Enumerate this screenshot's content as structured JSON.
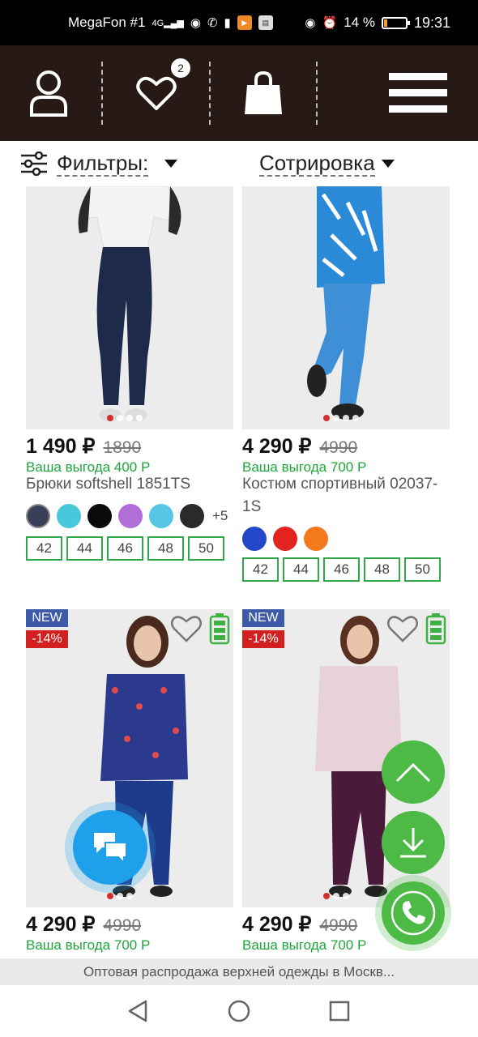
{
  "status_bar": {
    "carrier": "MegaFon #1",
    "signal_label": "4G",
    "battery": "14 %",
    "time": "19:31",
    "battery_level": 0.14
  },
  "header": {
    "account_icon": "user-icon",
    "wishlist_icon": "heart-icon",
    "wishlist_count": "2",
    "cart_icon": "bag-icon",
    "menu_icon": "hamburger-icon"
  },
  "toolbar": {
    "filter_label": "Фильтры:",
    "sort_label": "Сотрировка"
  },
  "colors": {
    "accent_green": "#2fa84a",
    "benefit_green": "#1ea53a",
    "header_bg": "#261916",
    "new_tag": "#3d5aa8",
    "discount_tag": "#d21f1f"
  },
  "products": [
    {
      "price": "1 490 ₽",
      "old_price": "1890",
      "benefit": "Ваша выгода 400 Р",
      "name": "Брюки softshell 1851TS",
      "colors": [
        "#3a3f58",
        "#49c8dc",
        "#0a0a0a",
        "#b06ed6",
        "#55c6e6",
        "#2a2a2a"
      ],
      "more_colors": "+5",
      "sizes": [
        "42",
        "44",
        "46",
        "48",
        "50"
      ]
    },
    {
      "price": "4 290 ₽",
      "old_price": "4990",
      "benefit": "Ваша выгода 700 Р",
      "name": "Костюм спортивный 02037-1S",
      "colors": [
        "#2446c8",
        "#e3231d",
        "#f4781c"
      ],
      "sizes": [
        "42",
        "44",
        "46",
        "48",
        "50"
      ]
    },
    {
      "new_tag": "NEW",
      "discount_tag": "-14%",
      "price": "4 290 ₽",
      "old_price": "4990",
      "benefit": "Ваша выгода 700 Р"
    },
    {
      "new_tag": "NEW",
      "discount_tag": "-14%",
      "price": "4 290 ₽",
      "old_price": "4990",
      "benefit": "Ваша выгода 700 Р"
    }
  ],
  "floating": {
    "chat_icon": "chat-bubbles-icon",
    "scroll_top_icon": "chevron-up-icon",
    "download_icon": "download-icon",
    "call_icon": "phone-icon"
  },
  "page_title_bar": "Оптовая распродажа верхней одежды в Москв...",
  "system_nav": {
    "back_icon": "back-triangle-icon",
    "home_icon": "home-circle-icon",
    "recents_icon": "recents-square-icon"
  }
}
